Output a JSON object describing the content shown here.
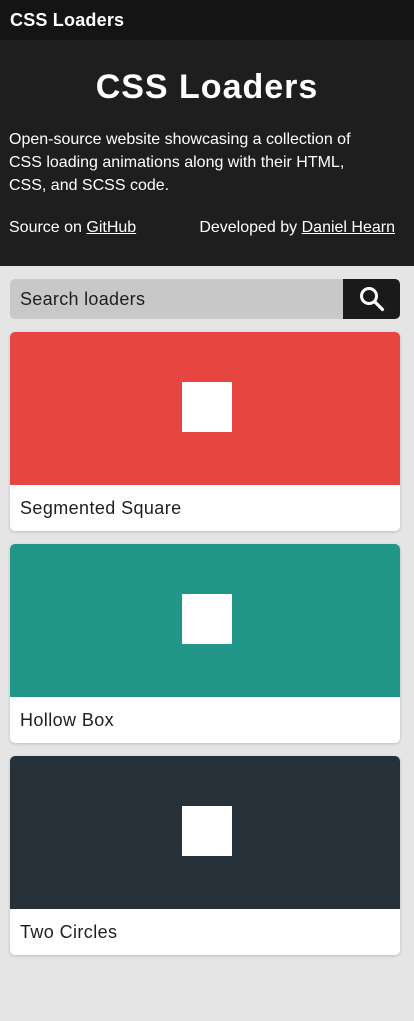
{
  "topbar": {
    "title": "CSS Loaders"
  },
  "hero": {
    "title": "CSS Loaders",
    "description": "Open-source website showcasing a collection of CSS loading animations along with their HTML, CSS, and SCSS code.",
    "source_prefix": "Source on ",
    "source_link": "GitHub",
    "dev_prefix": "Developed by ",
    "dev_link": "Daniel Hearn"
  },
  "search": {
    "placeholder": "Search loaders"
  },
  "loaders": [
    {
      "name": "Segmented Square",
      "color": "#e64541"
    },
    {
      "name": "Hollow Box",
      "color": "#219689"
    },
    {
      "name": "Two Circles",
      "color": "#263139"
    }
  ],
  "colors": {
    "topbar": "#141414",
    "hero": "#1f1e1f",
    "page_bg": "#e5e5e5",
    "search_bg": "#c8c8c8",
    "search_button": "#1a1a1a"
  }
}
